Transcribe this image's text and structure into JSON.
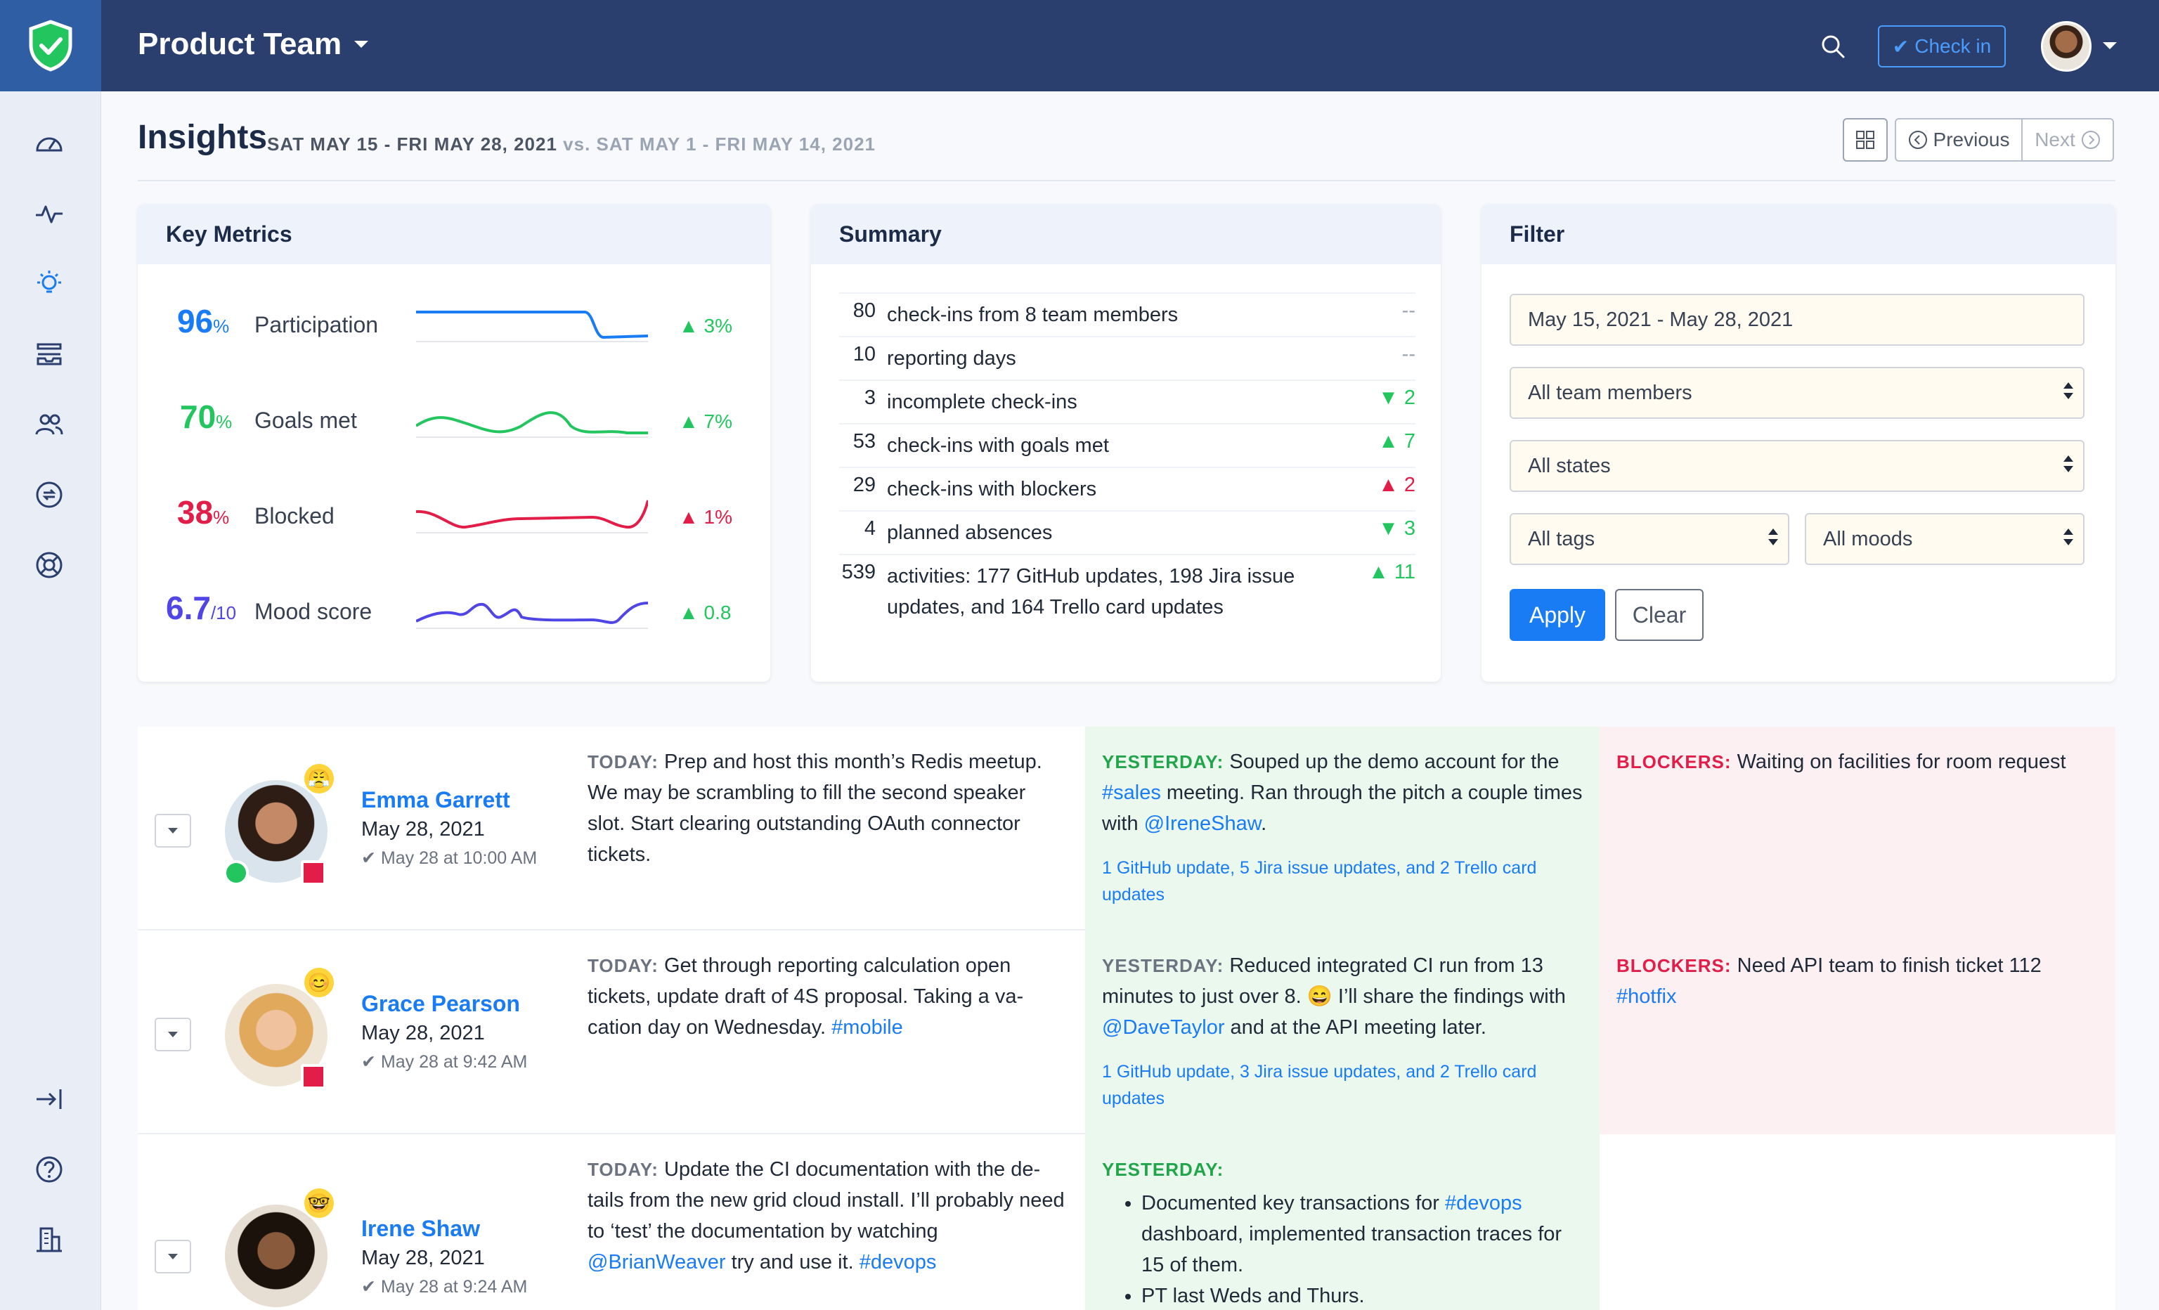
{
  "topbar": {
    "team_name": "Product Team",
    "checkin_label": "Check in"
  },
  "header": {
    "title": "Insights",
    "range": "SAT MAY 15 - FRI MAY 28, 2021",
    "vs_label": "vs.",
    "compare_range": "SAT MAY 1 - FRI MAY 14, 2021",
    "previous_label": "Previous",
    "next_label": "Next"
  },
  "key_metrics": {
    "title": "Key Metrics",
    "items": [
      {
        "value": "96",
        "unit": "%",
        "label": "Participation",
        "delta": "▲ 3%",
        "color": "#1a7cf5",
        "delta_color": "#22c55e"
      },
      {
        "value": "70",
        "unit": "%",
        "label": "Goals met",
        "delta": "▲ 7%",
        "color": "#22c55e",
        "delta_color": "#22c55e"
      },
      {
        "value": "38",
        "unit": "%",
        "label": "Blocked",
        "delta": "▲ 1%",
        "color": "#e11d48",
        "delta_color": "#e11d48"
      },
      {
        "value": "6.7",
        "unit": "/10",
        "label": "Mood score",
        "delta": "▲ 0.8",
        "color": "#4f46e5",
        "delta_color": "#22c55e"
      }
    ]
  },
  "summary": {
    "title": "Summary",
    "rows": [
      {
        "num": "80",
        "text": "check-ins from 8 team members",
        "delta": "--",
        "tone": "neutral"
      },
      {
        "num": "10",
        "text": "reporting days",
        "delta": "--",
        "tone": "neutral"
      },
      {
        "num": "3",
        "text": "incomplete check-ins",
        "delta": "▼ 2",
        "tone": "good"
      },
      {
        "num": "53",
        "text": "check-ins with goals met",
        "delta": "▲ 7",
        "tone": "good"
      },
      {
        "num": "29",
        "text": "check-ins with blockers",
        "delta": "▲ 2",
        "tone": "bad"
      },
      {
        "num": "4",
        "text": "planned absences",
        "delta": "▼ 3",
        "tone": "good"
      },
      {
        "num": "539",
        "text": "activities: 177 GitHub updates, 198 Jira issue updates, and 164 Trello card updates",
        "delta": "▲ 11",
        "tone": "good"
      }
    ]
  },
  "filter": {
    "title": "Filter",
    "date_value": "May 15, 2021 - May 28, 2021",
    "members": "All team members",
    "states": "All states",
    "tags": "All tags",
    "moods": "All moods",
    "apply_label": "Apply",
    "clear_label": "Clear"
  },
  "checkins": [
    {
      "name": "Emma Garrett",
      "date": "May 28, 2021",
      "time": "May 28 at 10:00 AM",
      "mood": "😤",
      "today_label": "TODAY:",
      "today_text": "Prep and host this month’s Redis meetup. We may be scrambling to fill the second speaker slot. Start clearing outstanding OAuth connector tickets.",
      "yesterday_label": "YESTERDAY:",
      "yesterday_pre": "Souped up the demo account for the ",
      "yesterday_tag": "#sales",
      "yesterday_mid": " meeting. Ran through the pitch a couple times with ",
      "yesterday_mention": "@IreneShaw",
      "yesterday_post": ".",
      "activities": "1 GitHub update, 5 Jira issue updates, and 2 Trello card updates",
      "blockers_label": "BLOCKERS:",
      "blockers_text": "Waiting on facilities for room request"
    },
    {
      "name": "Grace Pearson",
      "date": "May 28, 2021",
      "time": "May 28 at 9:42 AM",
      "mood": "😊",
      "today_label": "TODAY:",
      "today_text": "Get through reporting calculation open tickets, update draft of 4S proposal. Taking a va-cation day on Wednesday. ",
      "today_tag": "#mobile",
      "yesterday_label": "YESTERDAY:",
      "yesterday_pre": "Reduced integrated CI run from 13 minutes to just over 8. 😄 I’ll share the findings with ",
      "yesterday_mention": "@DaveTaylor",
      "yesterday_post": " and at the API meeting later.",
      "activities": "1 GitHub update, 3 Jira issue updates, and 2 Trello card updates",
      "blockers_label": "BLOCKERS:",
      "blockers_text": "Need API team to finish ticket 112 ",
      "blockers_tag": "#hotfix"
    },
    {
      "name": "Irene Shaw",
      "date": "May 28, 2021",
      "time": "May 28 at 9:24 AM",
      "mood": "🤓",
      "today_label": "TODAY:",
      "today_text": "Update the CI documentation with the de-tails from the new grid cloud install. I’ll probably need to ‘test’ the documentation by watching ",
      "today_mention": "@BrianWeaver",
      "today_post": " try and use it. ",
      "today_tag": "#devops",
      "yesterday_label": "YESTERDAY:",
      "yesterday_item1_pre": "Documented key transactions for ",
      "yesterday_item1_tag": "#devops",
      "yesterday_item1_post": " dashboard, implemented transaction traces for 15 of them.",
      "yesterday_item2": "PT last Weds and Thurs."
    }
  ],
  "colors": {
    "topbar": "#2b3f6e",
    "accent": "#1a7cf5",
    "good": "#22c55e",
    "bad": "#e11d48"
  }
}
